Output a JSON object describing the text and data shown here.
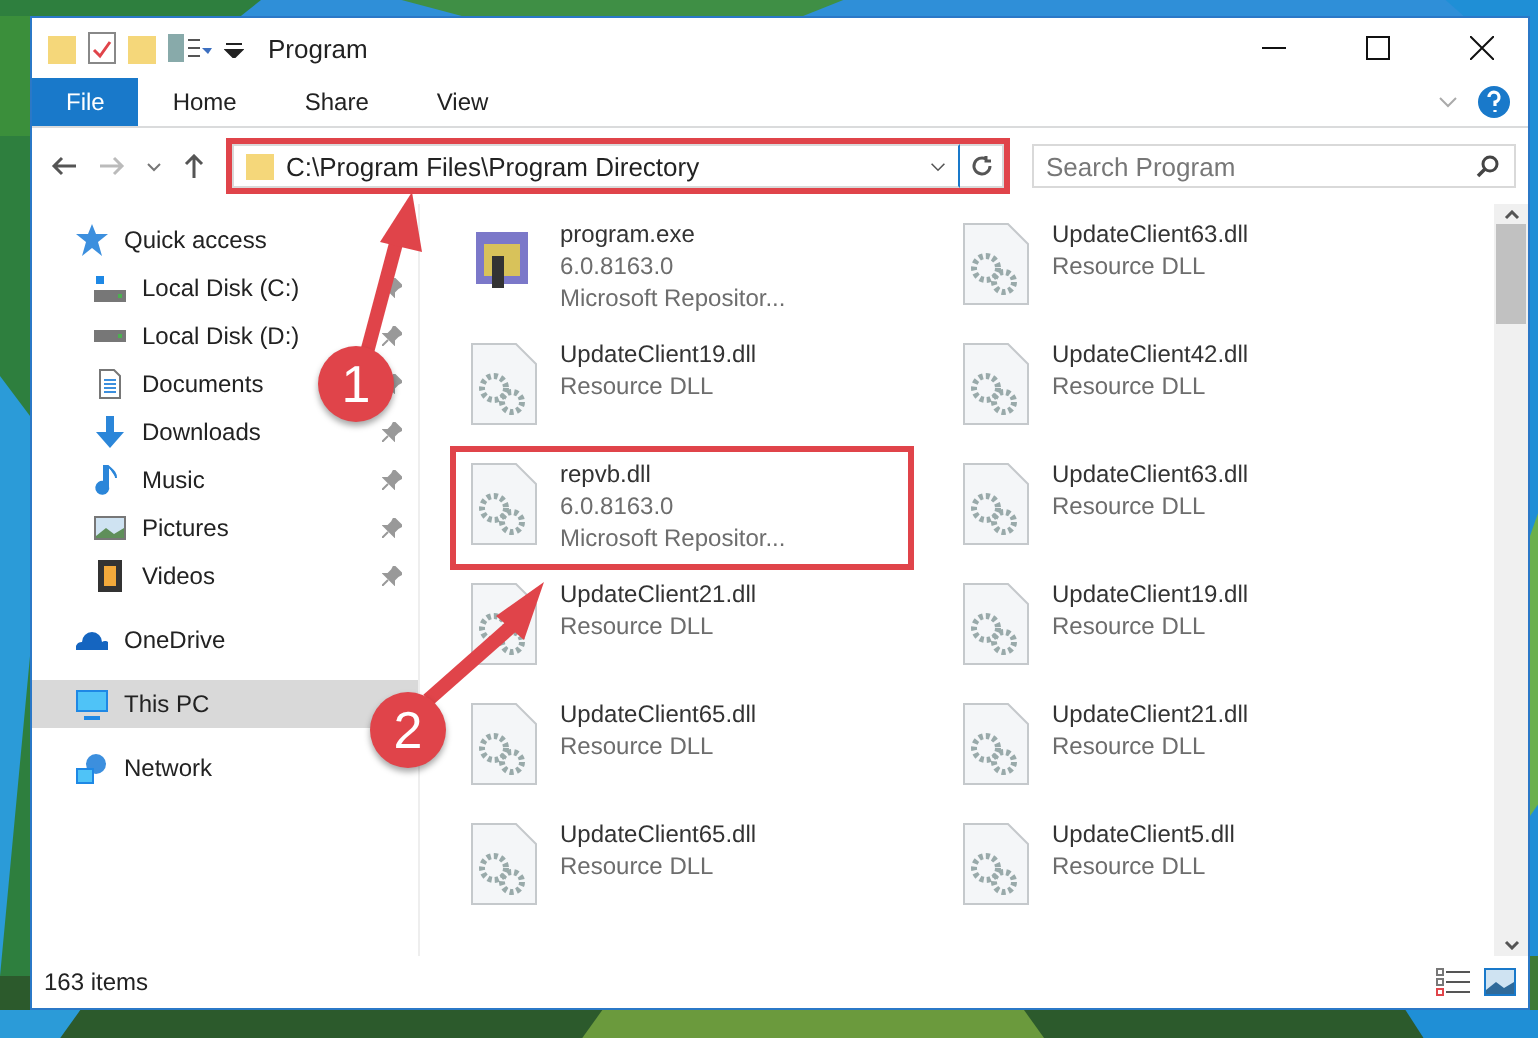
{
  "window": {
    "title": "Program"
  },
  "ribbon_tabs": [
    {
      "label": "File",
      "selected": true
    },
    {
      "label": "Home",
      "selected": false
    },
    {
      "label": "Share",
      "selected": false
    },
    {
      "label": "View",
      "selected": false
    }
  ],
  "address_bar": {
    "path": "C:\\Program Files\\Program Directory",
    "highlighted": true
  },
  "search": {
    "placeholder": "Search Program"
  },
  "sidebar": {
    "items": [
      {
        "label": "Quick access",
        "kind": "star",
        "selected": false,
        "children": [
          {
            "label": "Local Disk (C:)",
            "kind": "system-drive",
            "pinned": true
          },
          {
            "label": "Local Disk (D:)",
            "kind": "drive",
            "pinned": true
          },
          {
            "label": "Documents",
            "kind": "documents",
            "pinned": true
          },
          {
            "label": "Downloads",
            "kind": "download",
            "pinned": true
          },
          {
            "label": "Music",
            "kind": "music",
            "pinned": true
          },
          {
            "label": "Pictures",
            "kind": "pictures",
            "pinned": true
          },
          {
            "label": "Videos",
            "kind": "videos",
            "pinned": true
          }
        ]
      },
      {
        "label": "OneDrive",
        "kind": "cloud",
        "selected": false
      },
      {
        "label": "This PC",
        "kind": "pc",
        "selected": true
      },
      {
        "label": "Network",
        "kind": "network",
        "selected": false
      }
    ]
  },
  "files": [
    {
      "name": "program.exe",
      "kind": "exe",
      "lines": [
        "6.0.8163.0",
        "Microsoft Repositor..."
      ],
      "highlighted": false
    },
    {
      "name": "UpdateClient63.dll",
      "kind": "dll",
      "lines": [
        "Resource DLL"
      ],
      "highlighted": false
    },
    {
      "name": "UpdateClient19.dll",
      "kind": "dll",
      "lines": [
        "Resource DLL"
      ],
      "highlighted": false
    },
    {
      "name": "UpdateClient42.dll",
      "kind": "dll",
      "lines": [
        "Resource DLL"
      ],
      "highlighted": false
    },
    {
      "name": "repvb.dll",
      "kind": "dll",
      "lines": [
        "6.0.8163.0",
        "Microsoft Repositor..."
      ],
      "highlighted": true
    },
    {
      "name": "UpdateClient63.dll",
      "kind": "dll",
      "lines": [
        "Resource DLL"
      ],
      "highlighted": false
    },
    {
      "name": "UpdateClient21.dll",
      "kind": "dll",
      "lines": [
        "Resource DLL"
      ],
      "highlighted": false
    },
    {
      "name": "UpdateClient19.dll",
      "kind": "dll",
      "lines": [
        "Resource DLL"
      ],
      "highlighted": false
    },
    {
      "name": "UpdateClient65.dll",
      "kind": "dll",
      "lines": [
        "Resource DLL"
      ],
      "highlighted": false
    },
    {
      "name": "UpdateClient21.dll",
      "kind": "dll",
      "lines": [
        "Resource DLL"
      ],
      "highlighted": false
    },
    {
      "name": "UpdateClient65.dll",
      "kind": "dll",
      "lines": [
        "Resource DLL"
      ],
      "highlighted": false
    },
    {
      "name": "UpdateClient5.dll",
      "kind": "dll",
      "lines": [
        "Resource DLL"
      ],
      "highlighted": false
    }
  ],
  "status_bar": {
    "item_count": "163 items"
  },
  "annotations": [
    {
      "label": "1"
    },
    {
      "label": "2"
    }
  ]
}
